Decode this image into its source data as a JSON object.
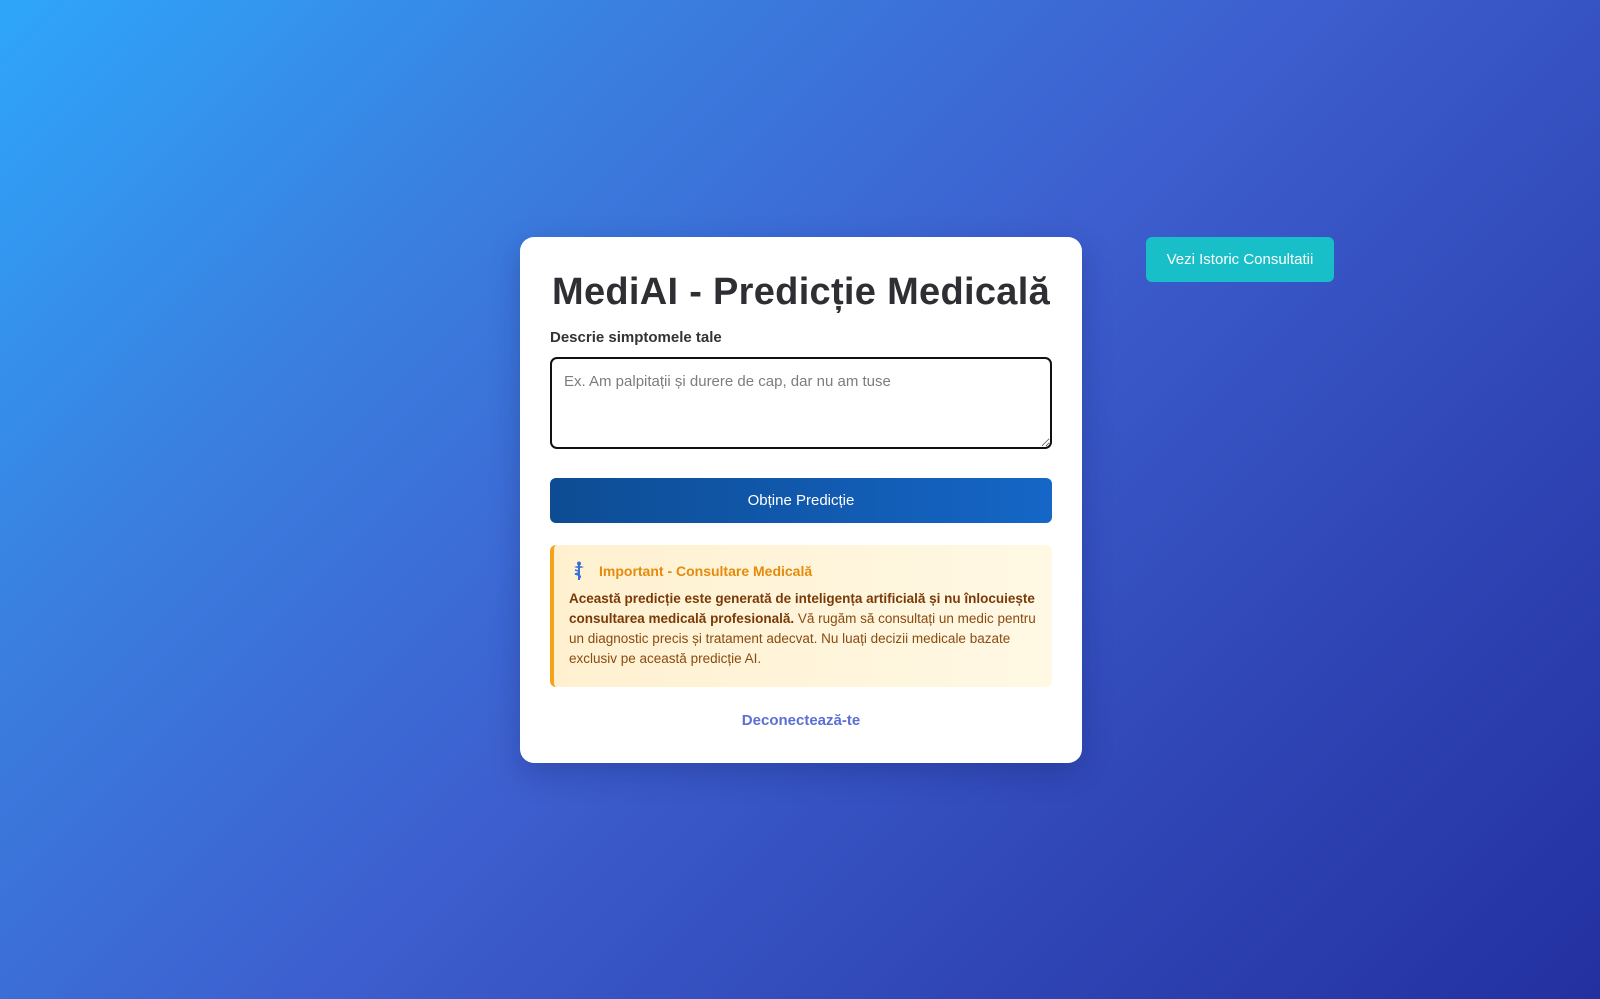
{
  "card": {
    "title": "MediAI - Predicție Medicală",
    "symptoms_label": "Descrie simptomele tale",
    "symptoms_value": "",
    "symptoms_placeholder": "Ex. Am palpitații și durere de cap, dar nu am tuse",
    "predict_button": "Obține Predicție",
    "logout_link": "Deconectează-te"
  },
  "notice": {
    "icon": "caduceus-icon",
    "title": "Important - Consultare Medicală",
    "body_bold": "Această predicție este generată de inteligența artificială și nu înlocuiește consultarea medicală profesională.",
    "body_rest": " Vă rugăm să consultați un medic pentru un diagnostic precis și tratament adecvat. Nu luați decizii medicale bazate exclusiv pe această predicție AI."
  },
  "header": {
    "history_button": "Vezi Istoric Consultatii"
  },
  "colors": {
    "accent": "#1566c7",
    "history_button": "#18bfc8",
    "notice_border": "#f2a41b",
    "link": "#5a6fd6"
  }
}
